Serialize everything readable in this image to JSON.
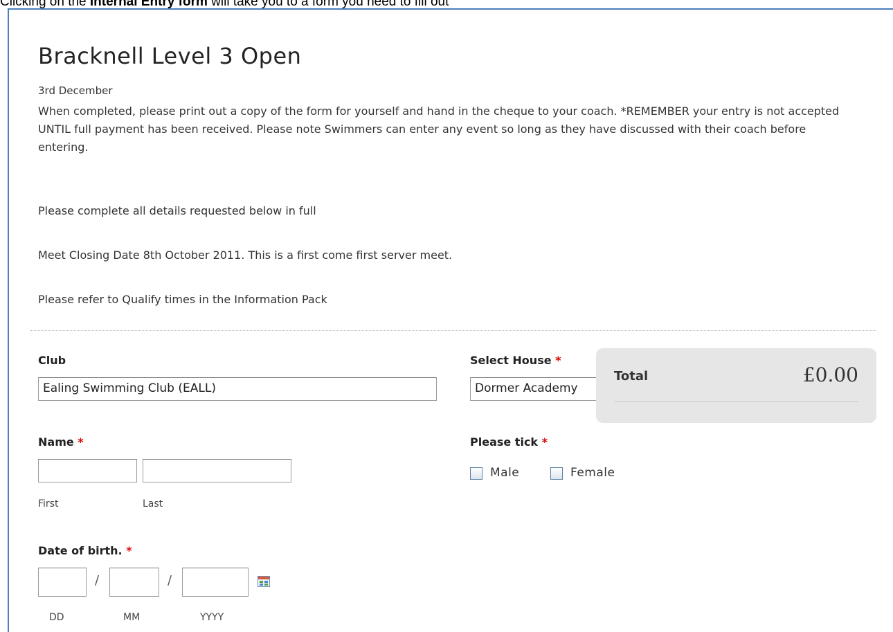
{
  "caption": {
    "prefix": "Clicking on the ",
    "emphasis": "Internal Entry form",
    "suffix": " will take you to a form you need to fill out"
  },
  "form": {
    "title": "Bracknell Level 3 Open",
    "date": "3rd December",
    "description": "When completed, please print out a copy of the form for yourself and hand in the cheque to your coach. *REMEMBER your entry is not accepted UNTIL full payment has been received. Please note Swimmers can enter any event so long as they have discussed with their coach before entering.",
    "note_complete": "Please complete all details requested below in full",
    "note_closing": "Meet Closing Date 8th October 2011. This is a first come first server meet.",
    "note_qualify": "Please refer to Qualify times in the Information Pack"
  },
  "fields": {
    "club": {
      "label": "Club",
      "value": "Ealing Swimming Club (EALL)"
    },
    "house": {
      "label": "Select House",
      "value": "Dormer Academy"
    },
    "name": {
      "label": "Name",
      "first_sublabel": "First",
      "last_sublabel": "Last",
      "first_value": "",
      "last_value": ""
    },
    "gender": {
      "label": "Please tick",
      "options": [
        "Male",
        "Female"
      ]
    },
    "dob": {
      "label": "Date of birth.",
      "day_sublabel": "DD",
      "month_sublabel": "MM",
      "year_sublabel": "YYYY",
      "separator": "/"
    }
  },
  "required_marker": "*",
  "total": {
    "label": "Total",
    "amount": "£0.00"
  },
  "icons": {
    "calendar": "calendar-icon"
  }
}
